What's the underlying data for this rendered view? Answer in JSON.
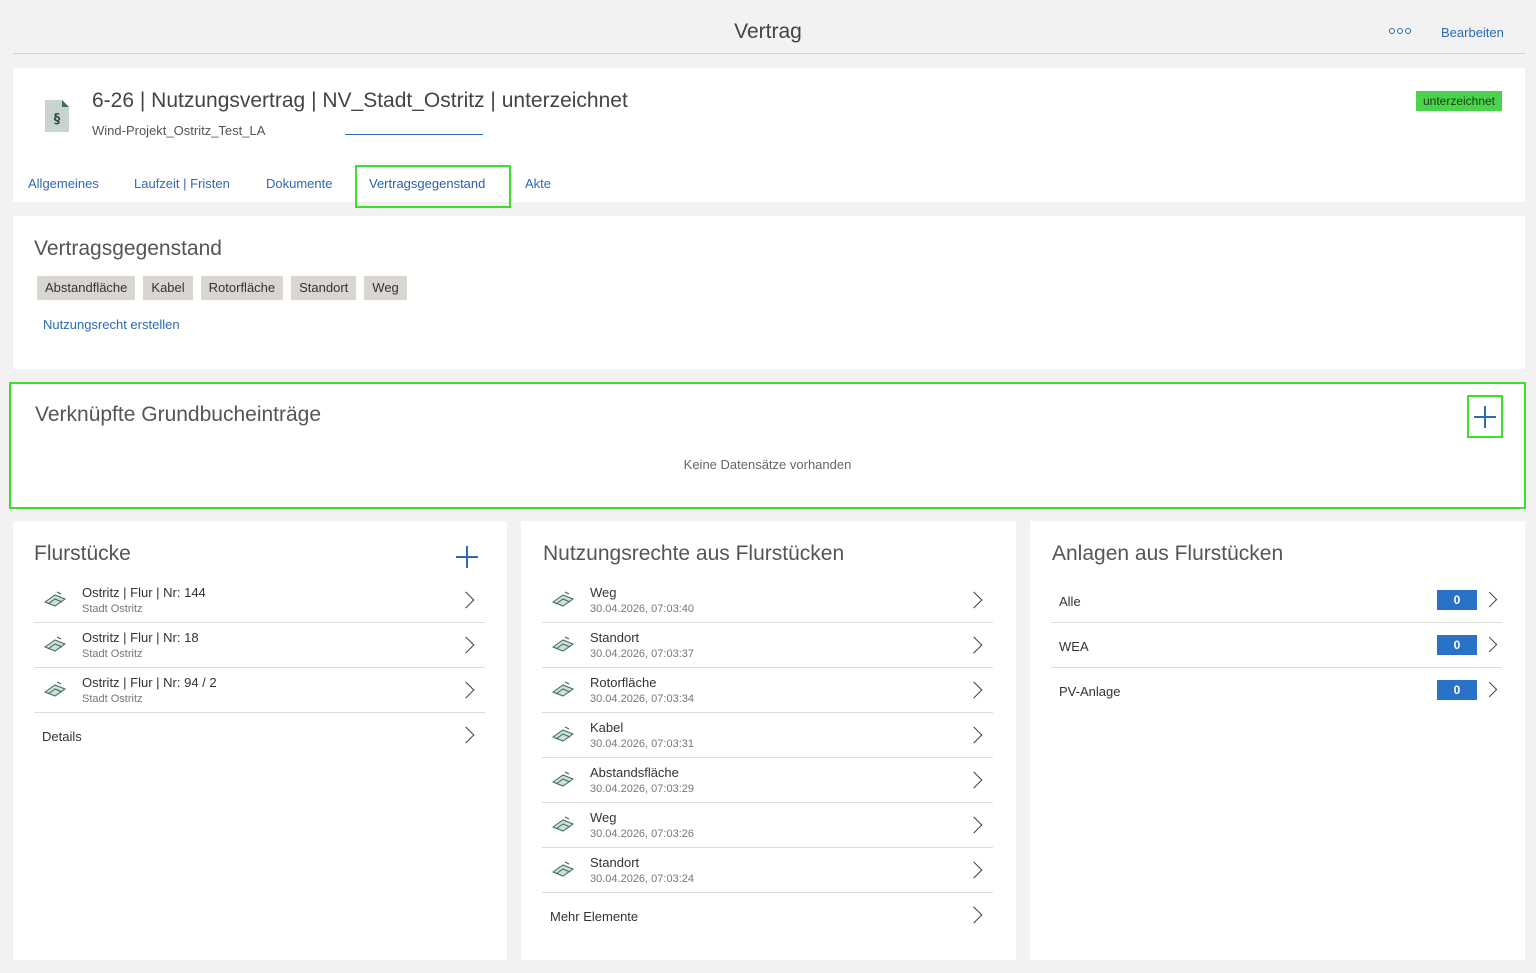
{
  "topbar": {
    "title": "Vertrag",
    "more_icon": "more-icon",
    "edit_label": "Bearbeiten"
  },
  "header": {
    "icon": "contract-paragraph-icon",
    "title": "6-26 | Nutzungsvertrag | NV_Stadt_Ostritz | unterzeichnet",
    "subtitle": "Wind-Projekt_Ostritz_Test_LA",
    "status": "unterzeichnet",
    "status_color": "#4cd34c",
    "tabs": [
      {
        "label": "Allgemeines"
      },
      {
        "label": "Laufzeit | Fristen"
      },
      {
        "label": "Dokumente"
      },
      {
        "label": "Vertragsgegenstand",
        "active": true
      },
      {
        "label": "Akte"
      }
    ]
  },
  "vertragsgegenstand": {
    "title": "Vertragsgegenstand",
    "chips": [
      "Abstandfläche",
      "Kabel",
      "Rotorfläche",
      "Standort",
      "Weg"
    ],
    "create_link": "Nutzungsrecht erstellen"
  },
  "grundbuch": {
    "title": "Verknüpfte Grundbucheinträge",
    "empty": "Keine Datensätze vorhanden"
  },
  "flurstuecke": {
    "title": "Flurstücke",
    "items": [
      {
        "title": "Ostritz | Flur | Nr: 144",
        "sub": "Stadt Ostritz"
      },
      {
        "title": "Ostritz | Flur | Nr: 18",
        "sub": "Stadt Ostritz"
      },
      {
        "title": "Ostritz | Flur | Nr: 94 / 2",
        "sub": "Stadt Ostritz"
      }
    ],
    "footer": "Details"
  },
  "nutzungsrechte": {
    "title": "Nutzungsrechte aus Flurstücken",
    "items": [
      {
        "title": "Weg",
        "sub": "30.04.2026, 07:03:40"
      },
      {
        "title": "Standort",
        "sub": "30.04.2026, 07:03:37"
      },
      {
        "title": "Rotorfläche",
        "sub": "30.04.2026, 07:03:34"
      },
      {
        "title": "Kabel",
        "sub": "30.04.2026, 07:03:31"
      },
      {
        "title": "Abstandsfläche",
        "sub": "30.04.2026, 07:03:29"
      },
      {
        "title": "Weg",
        "sub": "30.04.2026, 07:03:26"
      },
      {
        "title": "Standort",
        "sub": "30.04.2026, 07:03:24"
      }
    ],
    "footer": "Mehr Elemente"
  },
  "anlagen": {
    "title": "Anlagen aus Flurstücken",
    "items": [
      {
        "label": "Alle",
        "count": "0"
      },
      {
        "label": "WEA",
        "count": "0"
      },
      {
        "label": "PV-Anlage",
        "count": "0"
      }
    ]
  },
  "colors": {
    "accent": "#2a6ab8",
    "highlight": "#3ede2e",
    "count_badge": "#2a72c8"
  }
}
